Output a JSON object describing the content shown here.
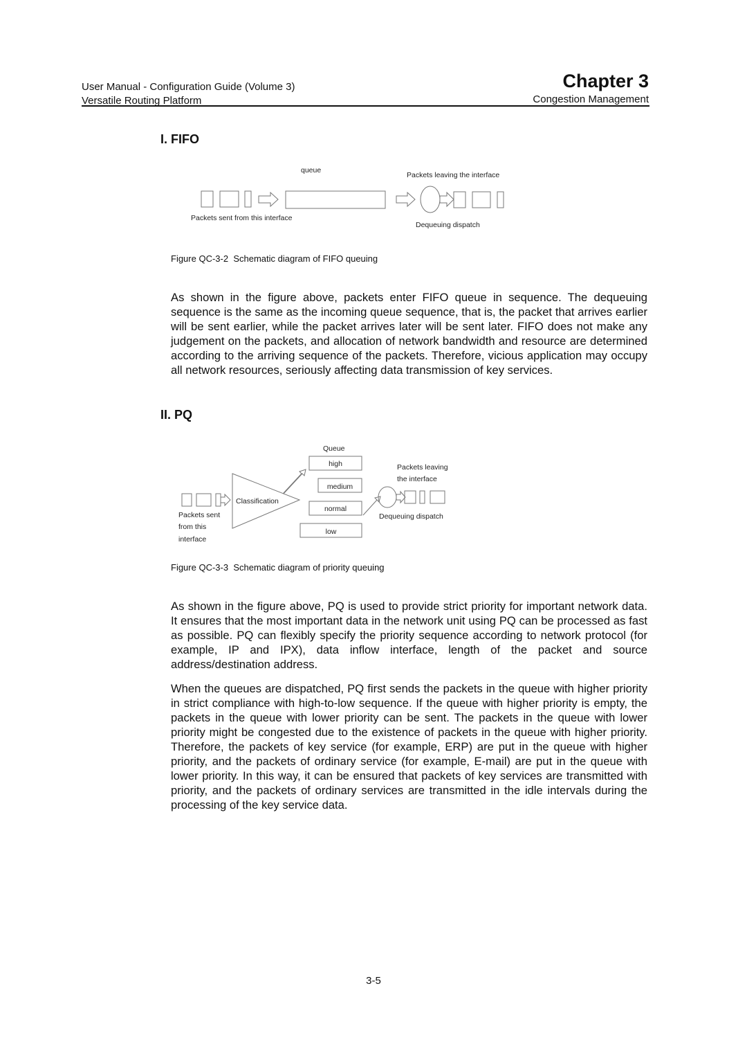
{
  "header": {
    "left_line1": "User Manual - Configuration Guide (Volume 3)",
    "left_line2": "Versatile Routing Platform",
    "chapter": "Chapter 3",
    "chapter_subtitle": "Congestion Management"
  },
  "sections": {
    "fifo": {
      "heading": "I. FIFO",
      "diagram": {
        "queue_label": "queue",
        "leaving_label": "Packets leaving the interface",
        "sent_label": "Packets sent from this interface",
        "dispatch_label": "Dequeuing dispatch"
      },
      "caption_number": "Figure QC-3-2",
      "caption_text": "Schematic diagram of FIFO queuing",
      "paragraph": "As shown in the figure above, packets enter FIFO queue in sequence. The dequeuing sequence is the same as the incoming queue sequence, that is, the packet that arrives earlier will be sent earlier, while the packet arrives later will be sent later. FIFO does not make any judgement on the packets, and allocation of network bandwidth and resource are determined according to the arriving sequence of the packets. Therefore, vicious application may occupy all network resources, seriously affecting data transmission of key services."
    },
    "pq": {
      "heading": "II. PQ",
      "diagram": {
        "queue_title": "Queue",
        "queues": [
          "high",
          "medium",
          "normal",
          "low"
        ],
        "classification_label": "Classification",
        "sent_label_1": "Packets sent",
        "sent_label_2": "from this",
        "sent_label_3": "interface",
        "leaving_label_1": "Packets leaving",
        "leaving_label_2": "the interface",
        "dispatch_label": "Dequeuing dispatch"
      },
      "caption_number": "Figure QC-3-3",
      "caption_text": "Schematic diagram of priority queuing",
      "paragraph1": "As shown in the figure above, PQ is used to provide strict priority for important network data. It ensures that the most important data in the network unit using PQ can be processed as fast as possible. PQ can flexibly specify the priority sequence according to network protocol (for example, IP and IPX), data inflow interface, length of the packet and source address/destination address.",
      "paragraph2": "When the queues are dispatched, PQ first sends the packets in the queue with higher priority in strict compliance with high-to-low sequence. If the queue with higher priority is empty, the packets in the queue with lower priority can be sent. The packets in the queue with lower priority might be congested due to the existence of packets in the queue with higher priority. Therefore, the packets of key service (for example, ERP) are put in the queue with higher priority, and the packets of ordinary service (for example, E-mail) are put in the queue with lower priority. In this way, it can be ensured that packets of key services are transmitted with priority, and the packets of ordinary services are transmitted in the idle intervals during the processing of the key service data."
    }
  },
  "footer": {
    "page_number": "3-5"
  }
}
